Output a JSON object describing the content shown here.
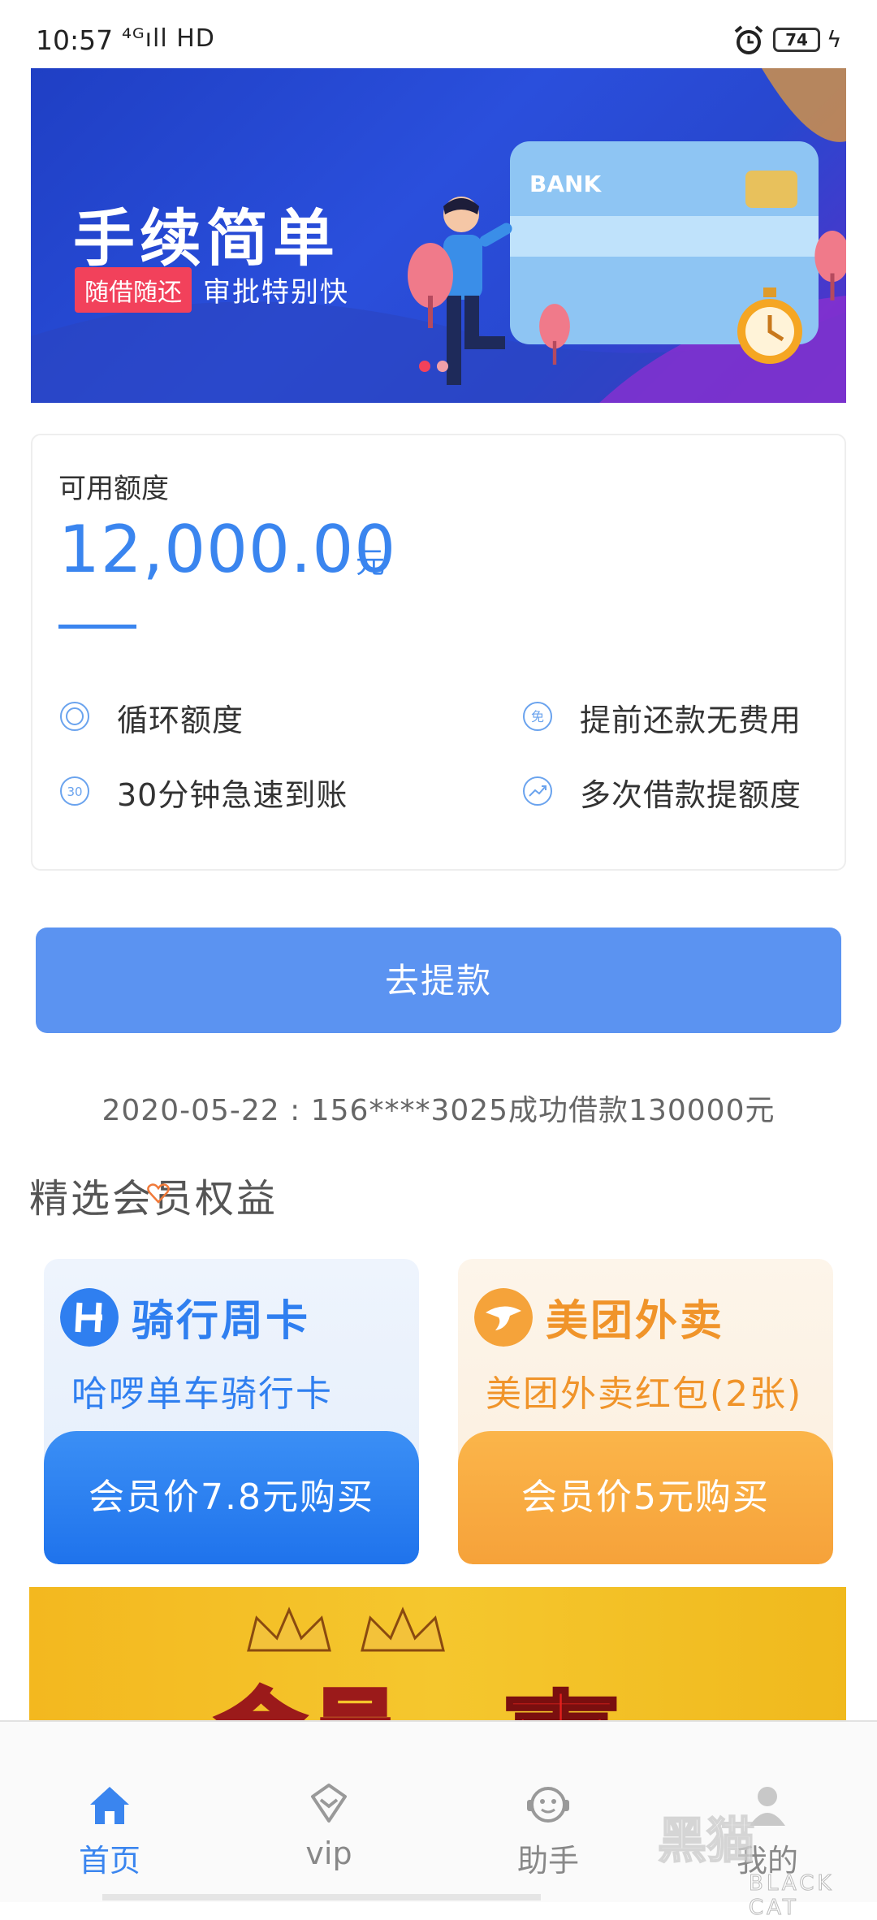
{
  "status_bar": {
    "time": "10:57",
    "network": "⁴ᴳıll HD",
    "battery": "74"
  },
  "banner": {
    "title": "手续简单",
    "tag": "随借随还",
    "subtitle": "审批特别快",
    "card_label": "BANK"
  },
  "credit": {
    "label": "可用额度",
    "amount": "12,000.00",
    "unit": "元",
    "features": [
      {
        "label": "循环额度",
        "icon": "circle-icon"
      },
      {
        "label": "提前还款无费用",
        "icon": "free-icon"
      },
      {
        "label": "30分钟急速到账",
        "icon": "thirty-icon"
      },
      {
        "label": "多次借款提额度",
        "icon": "trend-up-icon"
      }
    ]
  },
  "withdraw_button": "去提款",
  "loan_notice": "2020-05-22 : 156****3025成功借款130000元",
  "benefits": {
    "title": "精选会员权益",
    "cards": [
      {
        "name": "骑行周卡",
        "desc": "哈啰单车骑行卡",
        "buy": "会员价7.8元购买",
        "color": "#2f7ff0"
      },
      {
        "name": "美团外卖",
        "desc": "美团外卖红包(2张)",
        "buy": "会员价5元购买",
        "color": "#f5a33a"
      }
    ]
  },
  "promo": {
    "text1": "会员",
    "text2": "専"
  },
  "nav": {
    "items": [
      {
        "label": "首页",
        "icon": "home-icon"
      },
      {
        "label": "vip",
        "icon": "diamond-icon"
      },
      {
        "label": "助手",
        "icon": "assistant-icon"
      },
      {
        "label": "我的",
        "icon": "profile-icon"
      }
    ]
  },
  "watermark": {
    "cn": "黑猫",
    "en": "BLACK CAT"
  },
  "colors": {
    "accent": "#3a85ef",
    "button": "#5b93f1",
    "tag": "#f2415b"
  }
}
